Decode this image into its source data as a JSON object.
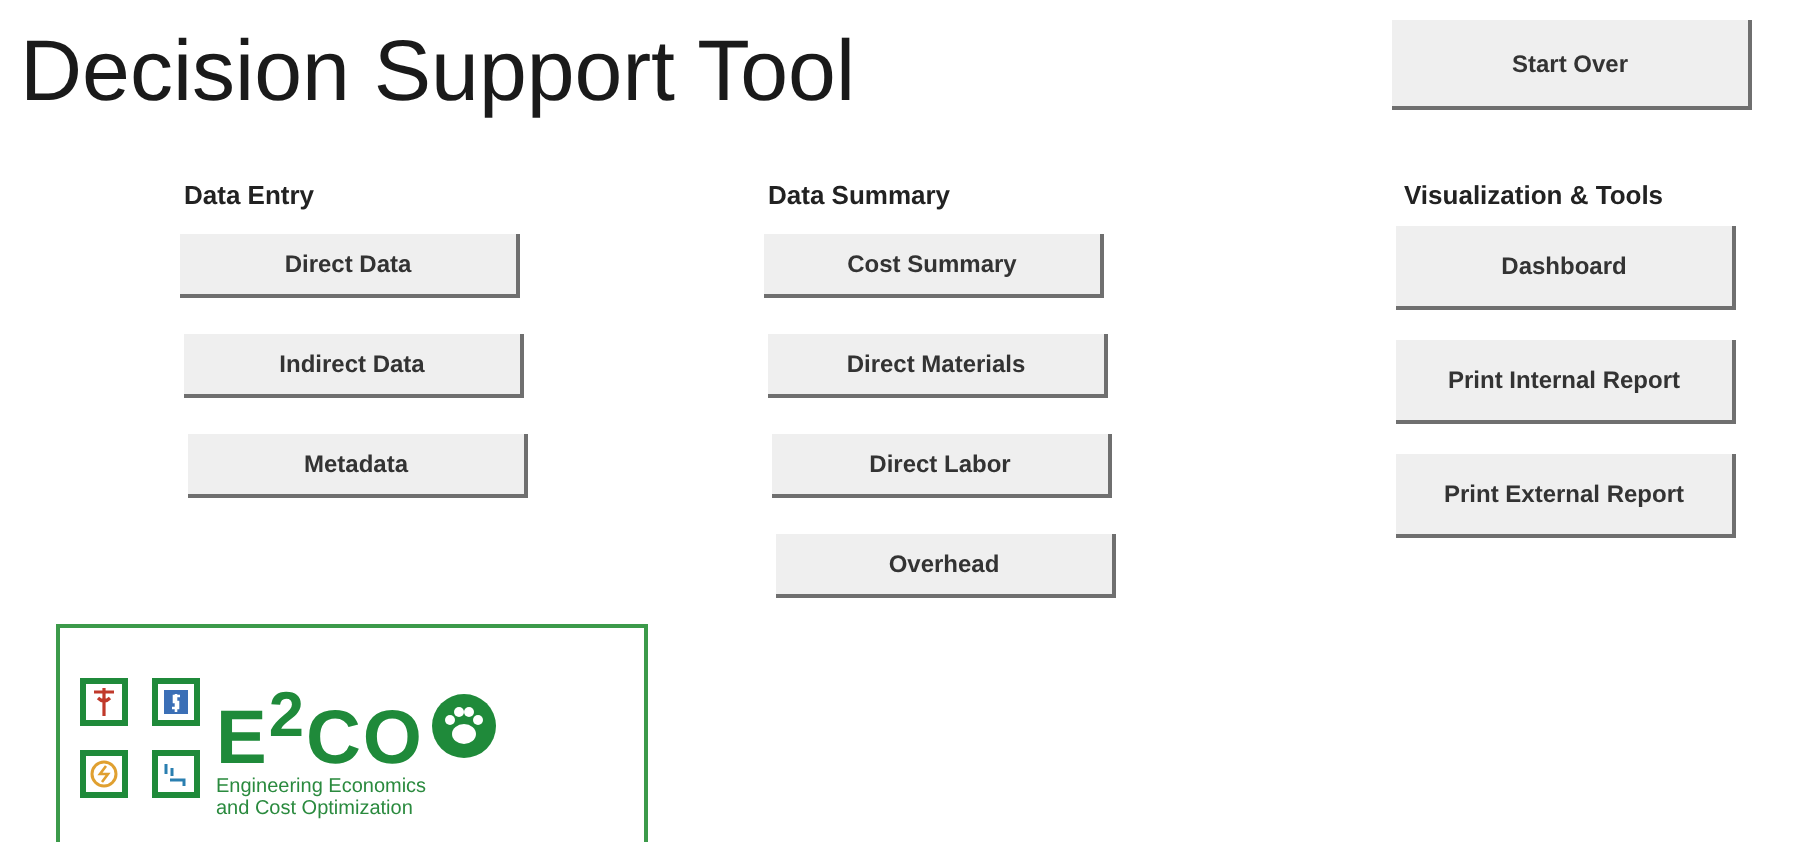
{
  "title": "Decision Support Tool",
  "start_over": "Start Over",
  "sections": [
    {
      "heading": "Data Entry",
      "buttons": [
        "Direct Data",
        "Indirect Data",
        "Metadata"
      ]
    },
    {
      "heading": "Data Summary",
      "buttons": [
        "Cost Summary",
        "Direct Materials",
        "Direct Labor",
        "Overhead"
      ]
    },
    {
      "heading": "Visualization & Tools",
      "buttons": [
        "Dashboard",
        "Print Internal Report",
        "Print External Report"
      ]
    }
  ],
  "logo": {
    "wordmark": "E$^{2}$CO",
    "tagline": [
      "Engineering Economics",
      "and Cost Optimization"
    ]
  }
}
